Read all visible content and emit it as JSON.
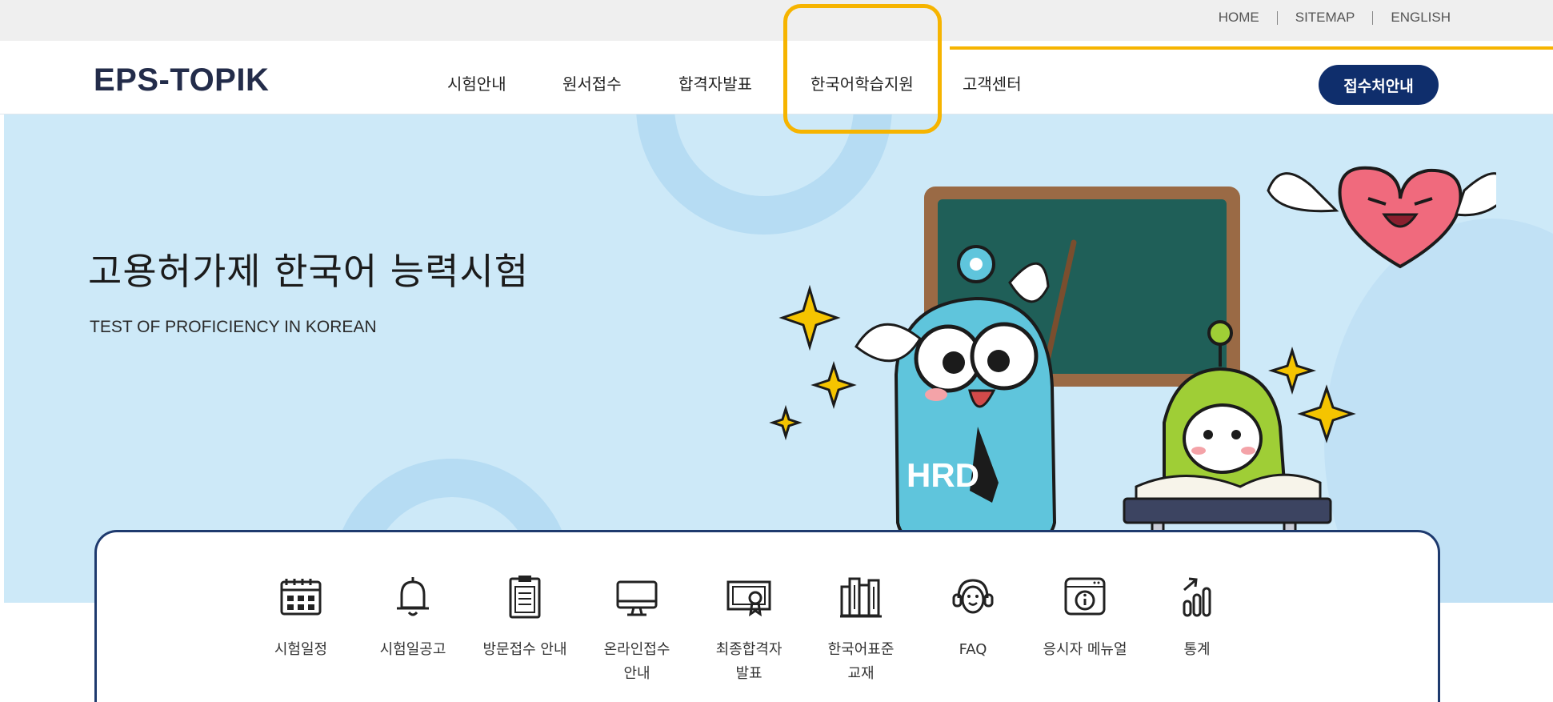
{
  "utility_nav": [
    "HOME",
    "SITEMAP",
    "ENGLISH"
  ],
  "logo": {
    "text": "EPS-TOPIK"
  },
  "main_nav": [
    "시험안내",
    "원서접수",
    "합격자발표",
    "한국어학습지원",
    "고객센터"
  ],
  "apply_button": "접수처안내",
  "hero": {
    "title": "고용허가제 한국어 능력시험",
    "subtitle": "TEST OF PROFICIENCY IN KOREAN"
  },
  "quick_menu": [
    {
      "label": "시험일정",
      "icon": "calendar-icon"
    },
    {
      "label": "시험일공고",
      "icon": "bell-icon"
    },
    {
      "label": "방문접수 안내",
      "icon": "clipboard-icon"
    },
    {
      "label": "온라인접수\n안내",
      "icon": "monitor-icon"
    },
    {
      "label": "최종합격자\n발표",
      "icon": "certificate-icon"
    },
    {
      "label": "한국어표준\n교재",
      "icon": "books-icon"
    },
    {
      "label": "FAQ",
      "icon": "headset-icon"
    },
    {
      "label": "응시자 메뉴얼",
      "icon": "info-window-icon"
    },
    {
      "label": "통계",
      "icon": "bar-chart-icon"
    }
  ],
  "colors": {
    "highlight": "#f6b400",
    "navy": "#0f2e6c",
    "hero_bg": "#cde9f8"
  }
}
